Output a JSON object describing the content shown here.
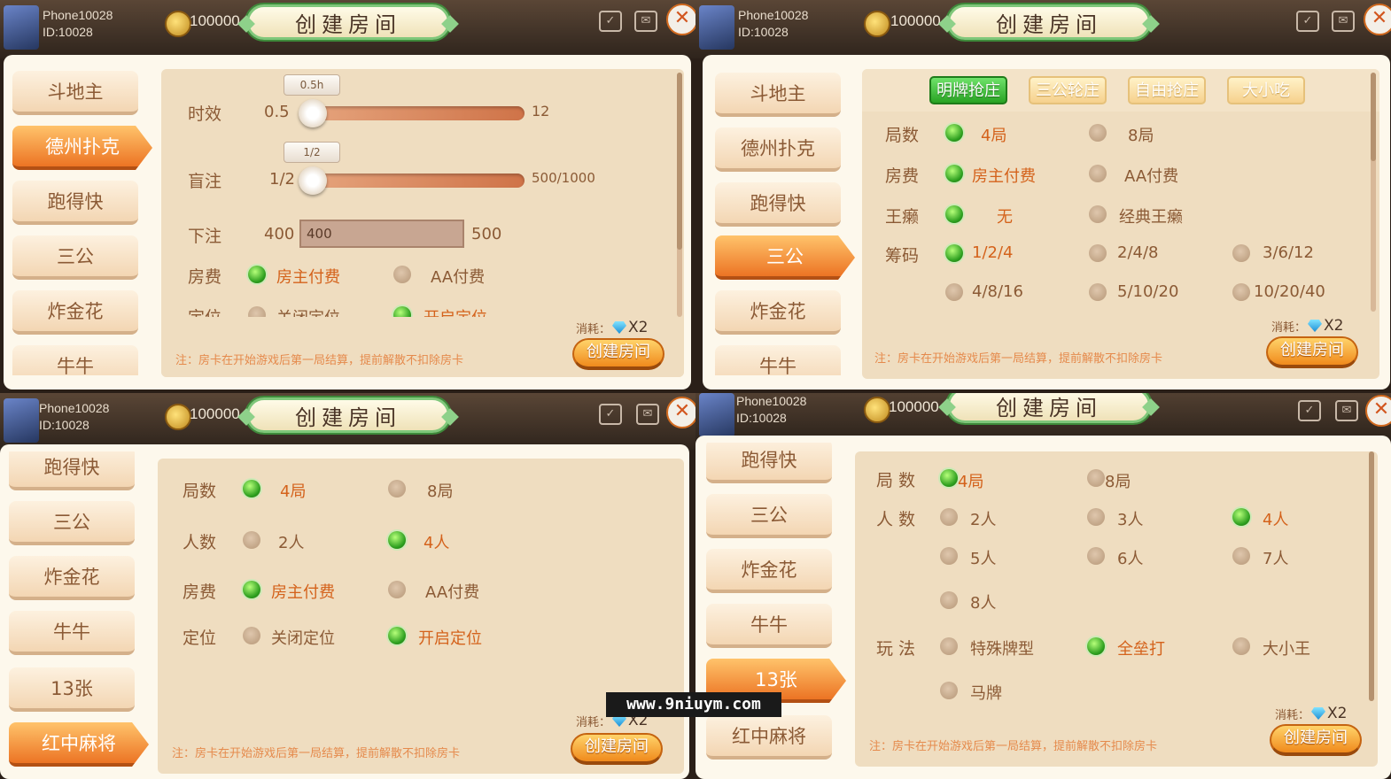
{
  "header": {
    "player_name": "Phone10028",
    "player_id": "ID:10028",
    "gold": "100000",
    "title": "创建房间",
    "cost_label": "消耗：",
    "cost_value": "X2"
  },
  "footer_note": "注：房卡在开始游戏后第一局结算，提前解散不扣除房卡",
  "create_button": "创建房间",
  "watermark": "www.9niuym.com",
  "q0": {
    "sidebar": [
      "斗地主",
      "德州扑克",
      "跑得快",
      "三公",
      "炸金花",
      "牛牛"
    ],
    "active": "德州扑克",
    "duration": {
      "label": "时效",
      "min": "0.5",
      "max": "12",
      "value": "0.5h"
    },
    "blind": {
      "label": "盲注",
      "min": "1/2",
      "max": "500/1000",
      "value": "1/2"
    },
    "bet": {
      "label": "下注",
      "min": "400",
      "max": "500",
      "value": "400"
    },
    "fee": {
      "label": "房费",
      "options": [
        "房主付费",
        "AA付费"
      ]
    },
    "location": {
      "label": "定位",
      "options": [
        "关闭定位",
        "开启定位"
      ]
    }
  },
  "q1": {
    "sidebar": [
      "斗地主",
      "德州扑克",
      "跑得快",
      "三公",
      "炸金花",
      "牛牛"
    ],
    "active": "三公",
    "tabs": [
      "明牌抢庄",
      "三公轮庄",
      "自由抢庄",
      "大小吃"
    ],
    "rounds": {
      "label": "局数",
      "options": [
        "4局",
        "8局"
      ]
    },
    "fee": {
      "label": "房费",
      "options": [
        "房主付费",
        "AA付费"
      ]
    },
    "wild": {
      "label": "王癞",
      "options": [
        "无",
        "经典王癞"
      ]
    },
    "chips": {
      "label": "筹码",
      "options": [
        "1/2/4",
        "2/4/8",
        "3/6/12",
        "4/8/16",
        "5/10/20",
        "10/20/40"
      ]
    }
  },
  "q2": {
    "sidebar": [
      "跑得快",
      "三公",
      "炸金花",
      "牛牛",
      "13张",
      "红中麻将"
    ],
    "active": "红中麻将",
    "rounds": {
      "label": "局数",
      "options": [
        "4局",
        "8局"
      ]
    },
    "players": {
      "label": "人数",
      "options": [
        "2人",
        "4人"
      ]
    },
    "fee": {
      "label": "房费",
      "options": [
        "房主付费",
        "AA付费"
      ]
    },
    "location": {
      "label": "定位",
      "options": [
        "关闭定位",
        "开启定位"
      ]
    }
  },
  "q3": {
    "player_name": "Phone10028",
    "sidebar": [
      "跑得快",
      "三公",
      "炸金花",
      "牛牛",
      "13张",
      "红中麻将"
    ],
    "active": "13张",
    "rounds": {
      "label": "局 数",
      "options": [
        "4局",
        "8局"
      ]
    },
    "players": {
      "label": "人 数",
      "options": [
        "2人",
        "3人",
        "4人",
        "5人",
        "6人",
        "7人",
        "8人"
      ]
    },
    "rules": {
      "label": "玩 法",
      "options": [
        "特殊牌型",
        "全垒打",
        "大小王",
        "马牌"
      ]
    }
  }
}
